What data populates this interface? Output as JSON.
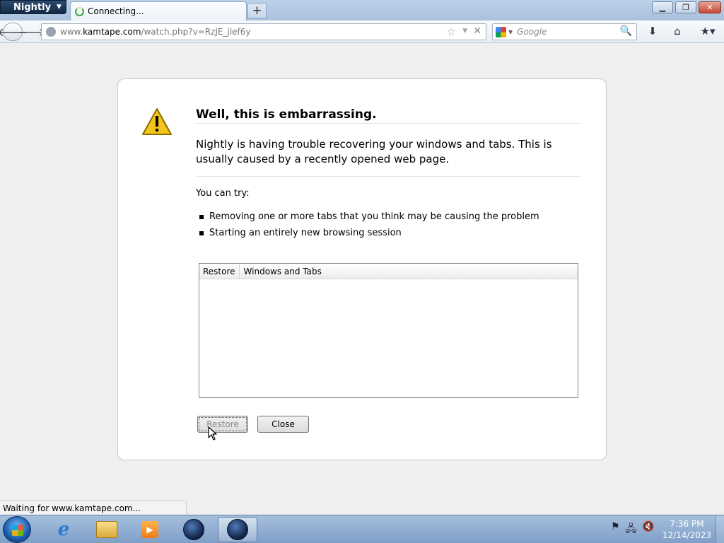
{
  "browser": {
    "app_menu_label": "Nightly",
    "tab_title": "Connecting...",
    "newtab_symbol": "+",
    "url_prefix": "www.",
    "url_domain": "kamtape.com",
    "url_path": "/watch.php?v=RzJE_jlef6y",
    "search_placeholder": "Google",
    "status_text": "Waiting for www.kamtape.com..."
  },
  "error_page": {
    "heading": "Well, this is embarrassing.",
    "description": "Nightly is having trouble recovering your windows and tabs. This is usually caused by a recently opened web page.",
    "try_heading": "You can try:",
    "suggestions": [
      "Removing one or more tabs that you think may be causing the problem",
      "Starting an entirely new browsing session"
    ],
    "tree_columns": [
      "Restore",
      "Windows and Tabs"
    ],
    "restore_button": "Restore",
    "close_button": "Close"
  },
  "taskbar": {
    "time": "7:36 PM",
    "date": "12/14/2023",
    "ie_label": "e"
  },
  "colors": {
    "warning_yellow": "#f3c41c",
    "close_button_red": "#c74a35"
  }
}
